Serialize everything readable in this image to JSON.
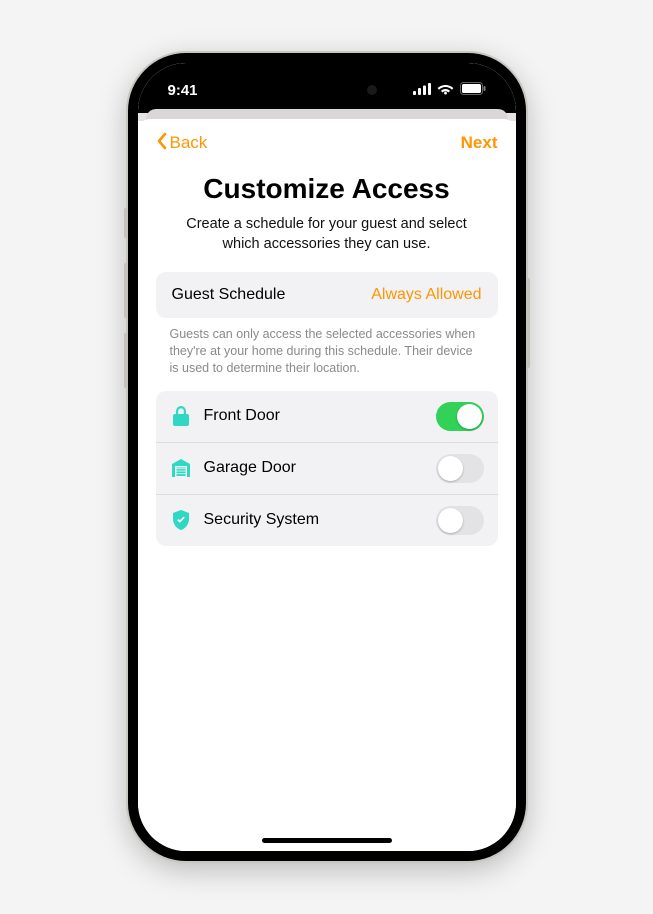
{
  "status": {
    "time": "9:41"
  },
  "nav": {
    "back_label": "Back",
    "next_label": "Next"
  },
  "page": {
    "title": "Customize Access",
    "subtitle": "Create a schedule for your guest and select which accessories they can use."
  },
  "schedule": {
    "label": "Guest Schedule",
    "value": "Always Allowed"
  },
  "help_text": "Guests can only access the selected accessories when they're at your home during this schedule. Their device is used to determine their location.",
  "accessories": [
    {
      "label": "Front Door",
      "icon": "lock-icon",
      "on": true
    },
    {
      "label": "Garage Door",
      "icon": "garage-icon",
      "on": false
    },
    {
      "label": "Security System",
      "icon": "shield-check-icon",
      "on": false
    }
  ],
  "colors": {
    "accent": "#ff9500",
    "teal": "#2fd7c4",
    "green": "#32d158"
  }
}
